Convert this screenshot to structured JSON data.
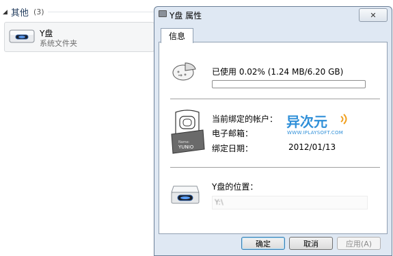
{
  "explorer": {
    "group_title": "其他",
    "group_count": "(3)",
    "drive": {
      "name": "Y盘",
      "type": "系统文件夹",
      "icon": "drive-icon"
    }
  },
  "dialog": {
    "title": "Y盘 属性",
    "close_label": "✕",
    "tab_label": "信息",
    "usage": {
      "label": "已使用 0.02% (1.24 MB/6.20 GB)",
      "percent": 0.02,
      "fill_color": "#3aa84a"
    },
    "account": {
      "account_label": "当前绑定的帐户：",
      "email_label": "电子邮箱：",
      "date_label": "绑定日期：",
      "date_value": "2012/01/13",
      "badge_text": "YUNIO",
      "badge_small": "Name:"
    },
    "brand": {
      "main": "异次元",
      "sub": "WWW.IPLAYSOFT.COM",
      "color": "#2f8fd8"
    },
    "location": {
      "label": "Y盘的位置：",
      "value": "Y:\\"
    },
    "buttons": {
      "ok": "确定",
      "cancel": "取消",
      "apply": "应用(A)"
    }
  }
}
